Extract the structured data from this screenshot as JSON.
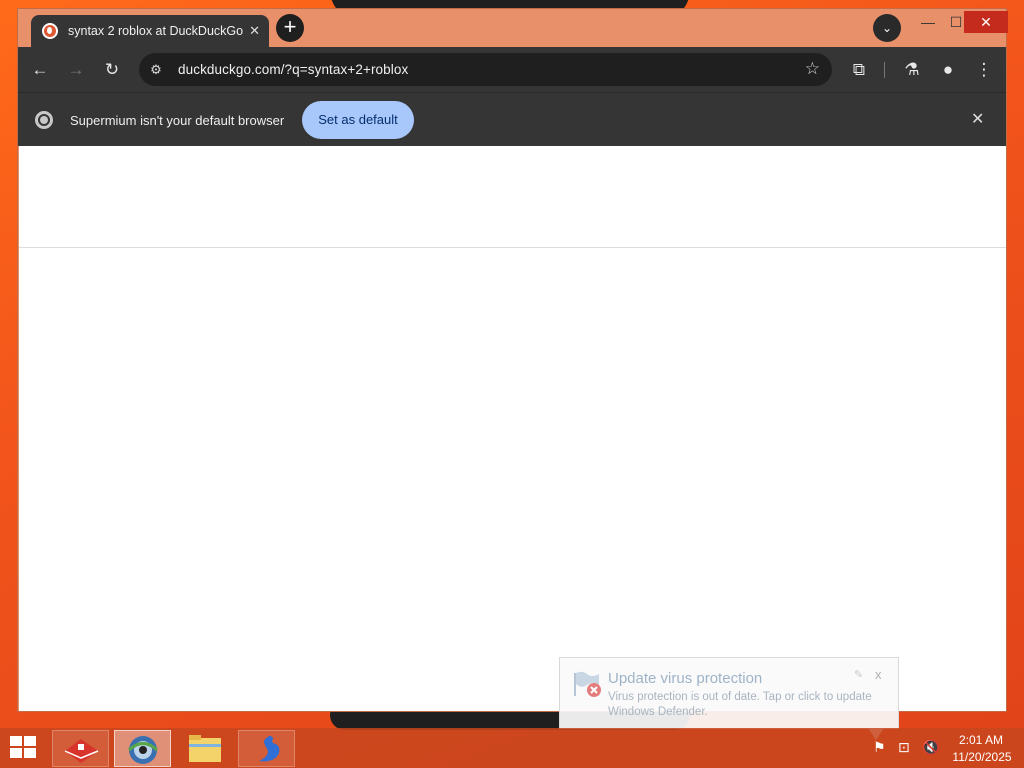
{
  "browser": {
    "tab": {
      "title": "syntax 2 roblox at DuckDuckGo",
      "close_glyph": "✕",
      "favicon": "duckduckgo-icon"
    },
    "new_tab_glyph": "+",
    "tab_search_glyph": "⌄",
    "window_controls": {
      "minimize": "—",
      "maximize": "☐",
      "close": "✕"
    },
    "toolbar": {
      "back": "←",
      "forward": "→",
      "reload": "↻",
      "url": "duckduckgo.com/?q=syntax+2+roblox",
      "site_info": "⚙",
      "bookmark": "☆",
      "extensions": "⧉",
      "labs": "⚗",
      "profile": "●",
      "menu": "⋮"
    },
    "infobar": {
      "message": "Supermium isn't your default browser",
      "button": "Set as default",
      "close": "✕"
    }
  },
  "notification": {
    "title": "Update virus protection",
    "body": "Virus protection is out of date. Tap or click to update Windows Defender.",
    "close": "x",
    "pin": "✎"
  },
  "taskbar": {
    "apps": [
      "toolbox-app",
      "supermium-browser",
      "file-explorer",
      "swan-app"
    ],
    "tray": {
      "flag": "⚑",
      "network": "⊡",
      "volume": "🔇"
    },
    "time": "2:01 AM",
    "date": "11/20/2025"
  },
  "colors": {
    "accent": "#a8c7fa",
    "desktop": "#f2541b",
    "chrome_dark": "#353535",
    "window_frame": "#e8906a"
  }
}
